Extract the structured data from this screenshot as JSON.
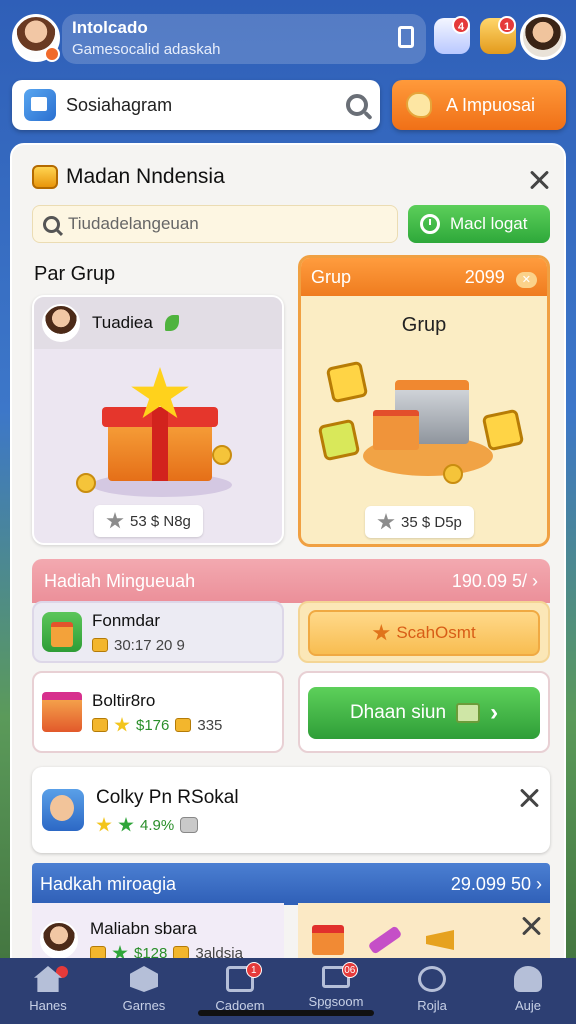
{
  "header": {
    "username": "Intolсаdo",
    "subtitle": "Gamesocalid adaskah",
    "badge_a": "4",
    "badge_b": "1"
  },
  "search": {
    "placeholder": "Sosiahagram"
  },
  "promo": {
    "label": "A Impuosai"
  },
  "panel": {
    "title": "Madan Nndensia",
    "filter_placeholder": "Tiudadelangeuan",
    "green_button": "Macl logat",
    "section_title": "Par Grup"
  },
  "card_left": {
    "name": "Tuadiea",
    "price": "53 $ N8g"
  },
  "card_right": {
    "header": "Grup",
    "header_value": "2099",
    "tag": "✕",
    "subtitle": "Grup",
    "price": "35 $ D5p"
  },
  "banner_pink": {
    "title": "Hadiah Mingueuah",
    "value": "190.09 5/"
  },
  "items": [
    {
      "title": "Fonmdar",
      "sub": "30:17 20 9"
    },
    {
      "title": "Boltir8ro",
      "sub_a": "$176",
      "sub_b": "335"
    }
  ],
  "buttons": {
    "orange": "ScahOsmt",
    "green": "Dhaan siun"
  },
  "notice": {
    "title": "Colky Pn RSokal",
    "sub": "4.9%"
  },
  "banner_blue": {
    "title": "Hadkah miroagia",
    "value": "29.099 50"
  },
  "item3": {
    "title": "Maliabn sbara",
    "sub_a": "$128",
    "sub_b": "3aldsia"
  },
  "bottom_nav": [
    {
      "label": "Hanes",
      "icon": "home-icon"
    },
    {
      "label": "Garnes",
      "icon": "games-icon"
    },
    {
      "label": "Cadoem",
      "icon": "calendar-icon",
      "badge": "1"
    },
    {
      "label": "Spgsoom",
      "icon": "monitor-icon",
      "badge": "06"
    },
    {
      "label": "Rojla",
      "icon": "compass-icon"
    },
    {
      "label": "Auje",
      "icon": "profile-icon"
    }
  ]
}
